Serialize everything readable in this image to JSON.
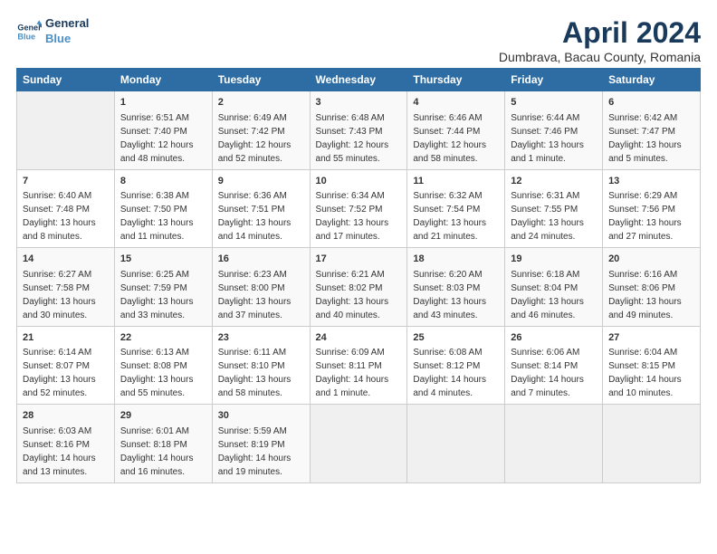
{
  "header": {
    "logo_line1": "General",
    "logo_line2": "Blue",
    "title": "April 2024",
    "subtitle": "Dumbrava, Bacau County, Romania"
  },
  "weekdays": [
    "Sunday",
    "Monday",
    "Tuesday",
    "Wednesday",
    "Thursday",
    "Friday",
    "Saturday"
  ],
  "weeks": [
    [
      {
        "day": "",
        "info": ""
      },
      {
        "day": "1",
        "info": "Sunrise: 6:51 AM\nSunset: 7:40 PM\nDaylight: 12 hours\nand 48 minutes."
      },
      {
        "day": "2",
        "info": "Sunrise: 6:49 AM\nSunset: 7:42 PM\nDaylight: 12 hours\nand 52 minutes."
      },
      {
        "day": "3",
        "info": "Sunrise: 6:48 AM\nSunset: 7:43 PM\nDaylight: 12 hours\nand 55 minutes."
      },
      {
        "day": "4",
        "info": "Sunrise: 6:46 AM\nSunset: 7:44 PM\nDaylight: 12 hours\nand 58 minutes."
      },
      {
        "day": "5",
        "info": "Sunrise: 6:44 AM\nSunset: 7:46 PM\nDaylight: 13 hours\nand 1 minute."
      },
      {
        "day": "6",
        "info": "Sunrise: 6:42 AM\nSunset: 7:47 PM\nDaylight: 13 hours\nand 5 minutes."
      }
    ],
    [
      {
        "day": "7",
        "info": "Sunrise: 6:40 AM\nSunset: 7:48 PM\nDaylight: 13 hours\nand 8 minutes."
      },
      {
        "day": "8",
        "info": "Sunrise: 6:38 AM\nSunset: 7:50 PM\nDaylight: 13 hours\nand 11 minutes."
      },
      {
        "day": "9",
        "info": "Sunrise: 6:36 AM\nSunset: 7:51 PM\nDaylight: 13 hours\nand 14 minutes."
      },
      {
        "day": "10",
        "info": "Sunrise: 6:34 AM\nSunset: 7:52 PM\nDaylight: 13 hours\nand 17 minutes."
      },
      {
        "day": "11",
        "info": "Sunrise: 6:32 AM\nSunset: 7:54 PM\nDaylight: 13 hours\nand 21 minutes."
      },
      {
        "day": "12",
        "info": "Sunrise: 6:31 AM\nSunset: 7:55 PM\nDaylight: 13 hours\nand 24 minutes."
      },
      {
        "day": "13",
        "info": "Sunrise: 6:29 AM\nSunset: 7:56 PM\nDaylight: 13 hours\nand 27 minutes."
      }
    ],
    [
      {
        "day": "14",
        "info": "Sunrise: 6:27 AM\nSunset: 7:58 PM\nDaylight: 13 hours\nand 30 minutes."
      },
      {
        "day": "15",
        "info": "Sunrise: 6:25 AM\nSunset: 7:59 PM\nDaylight: 13 hours\nand 33 minutes."
      },
      {
        "day": "16",
        "info": "Sunrise: 6:23 AM\nSunset: 8:00 PM\nDaylight: 13 hours\nand 37 minutes."
      },
      {
        "day": "17",
        "info": "Sunrise: 6:21 AM\nSunset: 8:02 PM\nDaylight: 13 hours\nand 40 minutes."
      },
      {
        "day": "18",
        "info": "Sunrise: 6:20 AM\nSunset: 8:03 PM\nDaylight: 13 hours\nand 43 minutes."
      },
      {
        "day": "19",
        "info": "Sunrise: 6:18 AM\nSunset: 8:04 PM\nDaylight: 13 hours\nand 46 minutes."
      },
      {
        "day": "20",
        "info": "Sunrise: 6:16 AM\nSunset: 8:06 PM\nDaylight: 13 hours\nand 49 minutes."
      }
    ],
    [
      {
        "day": "21",
        "info": "Sunrise: 6:14 AM\nSunset: 8:07 PM\nDaylight: 13 hours\nand 52 minutes."
      },
      {
        "day": "22",
        "info": "Sunrise: 6:13 AM\nSunset: 8:08 PM\nDaylight: 13 hours\nand 55 minutes."
      },
      {
        "day": "23",
        "info": "Sunrise: 6:11 AM\nSunset: 8:10 PM\nDaylight: 13 hours\nand 58 minutes."
      },
      {
        "day": "24",
        "info": "Sunrise: 6:09 AM\nSunset: 8:11 PM\nDaylight: 14 hours\nand 1 minute."
      },
      {
        "day": "25",
        "info": "Sunrise: 6:08 AM\nSunset: 8:12 PM\nDaylight: 14 hours\nand 4 minutes."
      },
      {
        "day": "26",
        "info": "Sunrise: 6:06 AM\nSunset: 8:14 PM\nDaylight: 14 hours\nand 7 minutes."
      },
      {
        "day": "27",
        "info": "Sunrise: 6:04 AM\nSunset: 8:15 PM\nDaylight: 14 hours\nand 10 minutes."
      }
    ],
    [
      {
        "day": "28",
        "info": "Sunrise: 6:03 AM\nSunset: 8:16 PM\nDaylight: 14 hours\nand 13 minutes."
      },
      {
        "day": "29",
        "info": "Sunrise: 6:01 AM\nSunset: 8:18 PM\nDaylight: 14 hours\nand 16 minutes."
      },
      {
        "day": "30",
        "info": "Sunrise: 5:59 AM\nSunset: 8:19 PM\nDaylight: 14 hours\nand 19 minutes."
      },
      {
        "day": "",
        "info": ""
      },
      {
        "day": "",
        "info": ""
      },
      {
        "day": "",
        "info": ""
      },
      {
        "day": "",
        "info": ""
      }
    ]
  ]
}
